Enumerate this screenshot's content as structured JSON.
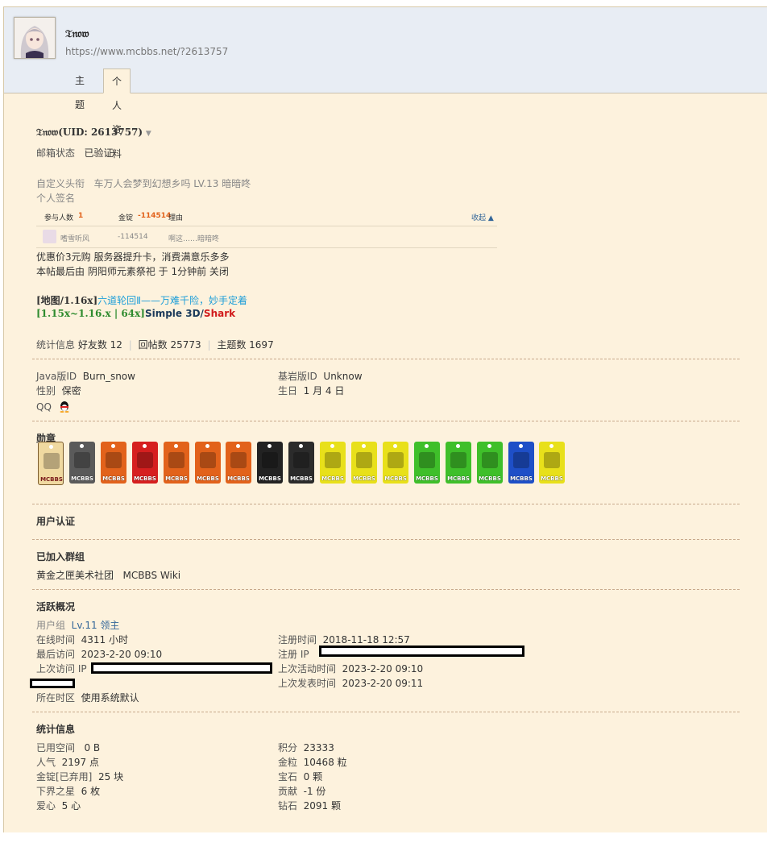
{
  "header": {
    "username": "𝔗𝔫𝔬𝔴",
    "url": "https://www.mcbbs.net/?2613757",
    "tabs": [
      {
        "label": "主题"
      },
      {
        "label": "个人资料"
      }
    ]
  },
  "profile": {
    "name_line": "𝔗𝔫𝔬𝔴(UID: 2613757)",
    "email_label": "邮箱状态",
    "email_value": "已验证",
    "custom_title_label": "自定义头衔",
    "custom_title_value": "车万人会梦到幻想乡吗 LV.13 暗暗咚",
    "signature_label": "个人签名",
    "sig_table": {
      "participants_label": "参与人数",
      "participants_value": "1",
      "gold_label": "金锭",
      "gold_value": "-114514",
      "reason_label": "理由",
      "collapse": "收起",
      "row_user": "嗜雪听风",
      "row_value": "-114514",
      "row_reason": "啊这……暗暗咚"
    },
    "sig_line1": "优惠价3元购 服务器提升卡，消费满意乐多多",
    "sig_line2": "本帖最后由 阴阳师元素祭祀 于 1分钟前 关闭",
    "map_prefix": "[地图/1.16x]",
    "map_title": "六道轮回Ⅱ——万难千险，妙手定着",
    "pack_prefix": "[1.15x~1.16.x | 64x]",
    "pack_mid": "Simple 3D/",
    "pack_shark": "Shark",
    "stats_label": "统计信息",
    "friends": "好友数 12",
    "replies": "回帖数 25773",
    "threads": "主题数 1697"
  },
  "ids": {
    "java_label": "Java版ID",
    "java_value": "Burn_snow",
    "bedrock_label": "基岩版ID",
    "bedrock_value": "Unknow",
    "gender_label": "性别",
    "gender_value": "保密",
    "birthday_label": "生日",
    "birthday_value": "1 月 4 日",
    "qq_label": "QQ"
  },
  "medals": {
    "title": "勋章",
    "tag": "MCBBS",
    "items": [
      {
        "icon": "clipboard-medal-icon",
        "color": "#f0d9a0"
      },
      {
        "icon": "globe-medal-icon",
        "color": "#5a5a5a"
      },
      {
        "icon": "orange-item-medal-icon",
        "color": "#e2621b"
      },
      {
        "icon": "java-medal-icon",
        "color": "#d61f1f"
      },
      {
        "icon": "plant-medal-icon",
        "color": "#e2621b"
      },
      {
        "icon": "leaf-medal-icon",
        "color": "#e2621b"
      },
      {
        "icon": "netherwart-medal-icon",
        "color": "#e2621b"
      },
      {
        "icon": "villager-medal-icon",
        "color": "#222222"
      },
      {
        "icon": "ore-medal-icon",
        "color": "#2b2b2b"
      },
      {
        "icon": "stone-pickaxe-medal-icon",
        "color": "#e8e01a"
      },
      {
        "icon": "iron-pickaxe-medal-icon",
        "color": "#e8e01a"
      },
      {
        "icon": "diamond-pickaxe-medal-icon",
        "color": "#e8e01a"
      },
      {
        "icon": "gold-ingot-medal-icon",
        "color": "#3fbf2a"
      },
      {
        "icon": "leather-medal-icon",
        "color": "#3fbf2a"
      },
      {
        "icon": "beef-medal-icon",
        "color": "#3fbf2a"
      },
      {
        "icon": "portrait-medal-icon",
        "color": "#1e4fc7"
      },
      {
        "icon": "miner-medal-icon",
        "color": "#e8e01a"
      }
    ]
  },
  "auth": {
    "title": "用户认证"
  },
  "groups": {
    "title": "已加入群组",
    "items": [
      "黄金之匣美术社团",
      "MCBBS Wiki"
    ]
  },
  "activity": {
    "title": "活跃概况",
    "group_label": "用户组",
    "group_value": "Lv.11 领主",
    "online_label": "在线时间",
    "online_value": "4311 小时",
    "reg_label": "注册时间",
    "reg_value": "2018-11-18 12:57",
    "last_visit_label": "最后访问",
    "last_visit_value": "2023-2-20 09:10",
    "reg_ip_label": "注册 IP",
    "last_ip_label": "上次访问 IP",
    "last_active_label": "上次活动时间",
    "last_active_value": "2023-2-20 09:10",
    "last_post_label": "上次发表时间",
    "last_post_value": "2023-2-20 09:11",
    "tz_label": "所在时区",
    "tz_value": "使用系统默认"
  },
  "stats": {
    "title": "统计信息",
    "space_label": "已用空间",
    "space_value": "0 B",
    "points_label": "积分",
    "points_value": "23333",
    "pop_label": "人气",
    "pop_value": "2197 点",
    "nugget_label": "金粒",
    "nugget_value": "10468 粒",
    "ingot_label": "金锭[已弃用]",
    "ingot_value": "25 块",
    "gem_label": "宝石",
    "gem_value": "0 颗",
    "nether_label": "下界之星",
    "nether_value": "6 枚",
    "contrib_label": "贡献",
    "contrib_value": "-1 份",
    "love_label": "爱心",
    "love_value": "5 心",
    "diamond_label": "钻石",
    "diamond_value": "2091 颗"
  }
}
